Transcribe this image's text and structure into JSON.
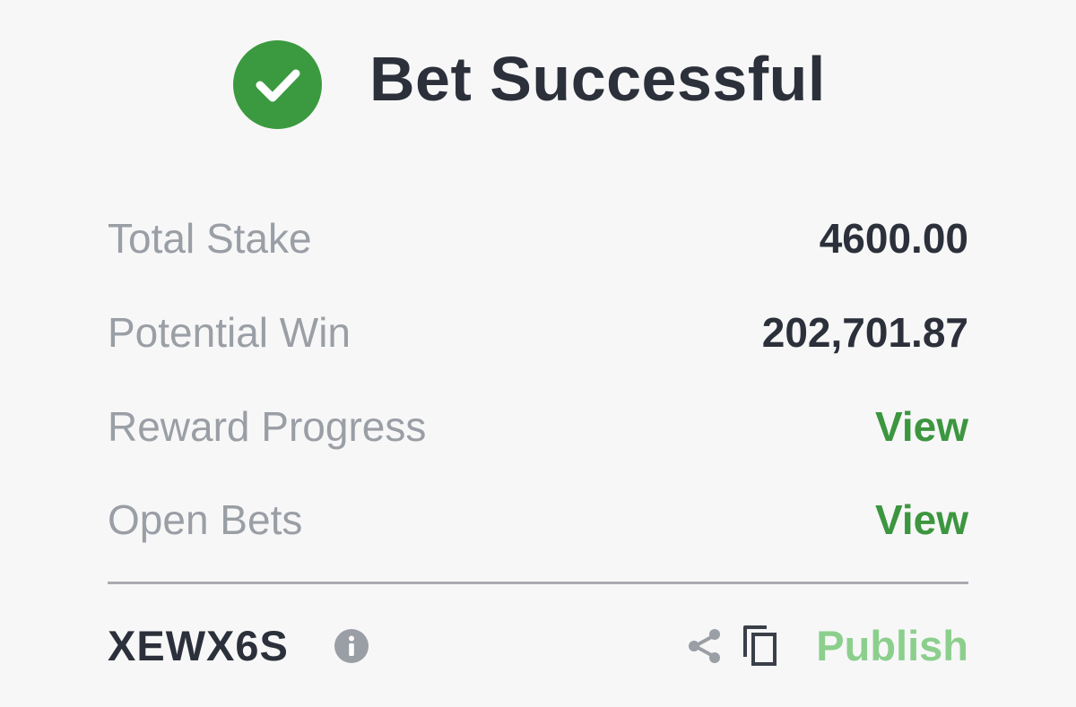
{
  "header": {
    "title": "Bet Successful",
    "icon": "check-circle-icon",
    "icon_color": "#3b9a3f"
  },
  "summary": {
    "rows": [
      {
        "label": "Total Stake",
        "value": "4600.00"
      },
      {
        "label": "Potential Win",
        "value": "202,701.87"
      },
      {
        "label": "Reward Progress",
        "link": "View"
      },
      {
        "label": "Open Bets",
        "link": "View"
      }
    ]
  },
  "footer": {
    "booking_code": "XEWX6S",
    "info_icon": "info-icon",
    "share_icon": "share-icon",
    "copy_icon": "copy-icon",
    "publish_label": "Publish"
  },
  "colors": {
    "accent_green": "#3c963f",
    "muted_green": "#8ccf8d",
    "label_gray": "#9a9ea5",
    "text_dark": "#2b303a"
  }
}
